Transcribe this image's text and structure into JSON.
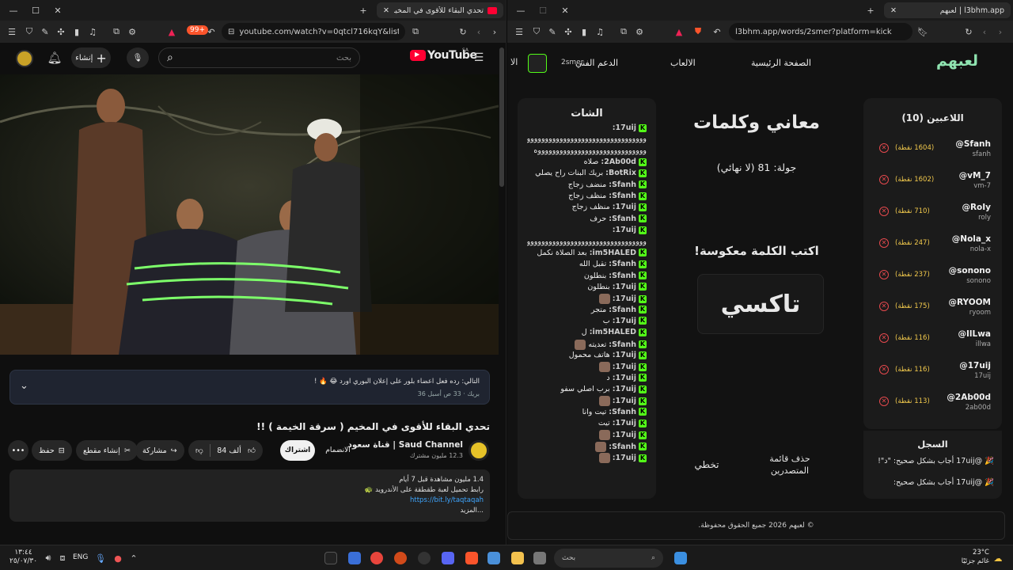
{
  "left_browser": {
    "tab_title": "تحدي البقاء للأقوى في المخيم (",
    "url": "youtube.com/watch?v=0qtcl716kqY&list=...",
    "badge_count": "99+"
  },
  "youtube": {
    "logo": "YouTube",
    "logo_region": "SA",
    "search_placeholder": "بحث",
    "create_label": "إنشاء",
    "comment_pinned": "التالي: رده فعل اعضاء بلور على إعلان البوري اورد 😂 🔥 !",
    "comment_meta": "بريك · 33 ص أسبل 36",
    "video_title": "تحدي البقاء للأقوى في المخيم ( سرقة الخيمة ) !!",
    "channel_name": "Saud Channel | قناة سعود",
    "subscribers": "12.3 مليون مشترك",
    "subscribe_label": "اشتراك",
    "join_label": "الانضمام",
    "likes": "84 ألف",
    "share_label": "مشاركة",
    "clip_label": "إنشاء مقطع",
    "save_label": "حفظ",
    "desc_stats": "1.4 مليون مشاهدة قبل 7 أيام",
    "desc_line2": "رابط تحميل لعبة طقطقة على الأندرويد 🐢",
    "desc_link": "https://bit.ly/taqtaqah",
    "desc_more": "...المزيد"
  },
  "right_browser": {
    "tab_title": "l3bhm.app | لعبهم",
    "url": "l3bhm.app/words/2smer?platform=kick"
  },
  "site": {
    "logo": "لعبهم",
    "nav": [
      "الصفحة الرئيسية",
      "الالعاب",
      "الدعم الفني",
      "الا"
    ],
    "username": "2smer",
    "players_title": "اللاعبين (10)",
    "players": [
      {
        "name": "@Sfanh",
        "sub": "sfanh",
        "points": "(1604 نقطة)"
      },
      {
        "name": "@vM_7",
        "sub": "vm-7",
        "points": "(1602 نقطة)"
      },
      {
        "name": "@RoIy",
        "sub": "roly",
        "points": "(710 نقطة)"
      },
      {
        "name": "@Nola_x",
        "sub": "nola-x",
        "points": "(247 نقطة)"
      },
      {
        "name": "@sonono",
        "sub": "sonono",
        "points": "(237 نقطة)"
      },
      {
        "name": "@RYOOM",
        "sub": "ryoom",
        "points": "(175 نقطة)"
      },
      {
        "name": "@IlLwa",
        "sub": "illwa",
        "points": "(116 نقطة)"
      },
      {
        "name": "@17uij",
        "sub": "17uij",
        "points": "(116 نقطة)"
      },
      {
        "name": "@2Ab00d",
        "sub": "2ab00d",
        "points": "(113 نقطة)"
      }
    ],
    "game_title": "معاني وكلمات",
    "round": "جولة: 81 (لا نهائي)",
    "instruction": "اكتب الكلمة معكوسة!",
    "word": "تاكسي",
    "skip": "تخطي",
    "clear_leaderboard": "حذف قائمة المتصدرين",
    "log_title": "السجل",
    "log": [
      "🎉 @17uij أجاب بشكل صحيح: \"د\"!",
      "🎉 @17uij أجاب بشكل صحيح:"
    ],
    "chat_title": "الشات",
    "chat": [
      {
        "u": "17uij:",
        "t": ""
      },
      {
        "u": "",
        "t": "ووووووووووووووووووووووووووووووووو"
      },
      {
        "u": "",
        "t": "ووووووووووووووووووووووووووووووه"
      },
      {
        "u": "2Ab00d:",
        "t": "صلاه"
      },
      {
        "u": "BotRix:",
        "t": "بريك البنات راح يصلي"
      },
      {
        "u": "Sfanh:",
        "t": "منضف زجاج"
      },
      {
        "u": "Sfanh:",
        "t": "منظف زجاج"
      },
      {
        "u": "17uij:",
        "t": "منظف زجاج"
      },
      {
        "u": "Sfanh:",
        "t": "حرف"
      },
      {
        "u": "17uij:",
        "t": ""
      },
      {
        "u": "",
        "t": "ووووووووووووووووووووووووووووووووو"
      },
      {
        "u": "im5HALED:",
        "t": "بعد الصلاة نكمل"
      },
      {
        "u": "Sfanh:",
        "t": "تقبل الله"
      },
      {
        "u": "Sfanh:",
        "t": "بنطلون"
      },
      {
        "u": "17uij:",
        "t": "بنطلون"
      },
      {
        "u": "17uij:",
        "t": "EMOTE"
      },
      {
        "u": "Sfanh:",
        "t": "متجر"
      },
      {
        "u": "17uij:",
        "t": "ب"
      },
      {
        "u": "im5HALED:",
        "t": "ل"
      },
      {
        "u": "Sfanh:",
        "t": "تعديته EMOTE"
      },
      {
        "u": "17uij:",
        "t": "هاتف محمول"
      },
      {
        "u": "17uij:",
        "t": "EMOTE"
      },
      {
        "u": "17uij:",
        "t": "د"
      },
      {
        "u": "17uij:",
        "t": "برب اصلي سفو"
      },
      {
        "u": "17uij:",
        "t": "EMOTE"
      },
      {
        "u": "Sfanh:",
        "t": "تيت وانا"
      },
      {
        "u": "17uij:",
        "t": "تيت"
      },
      {
        "u": "17uij:",
        "t": "EMOTE"
      },
      {
        "u": "Sfanh:",
        "t": "EMOTE"
      },
      {
        "u": "17uij:",
        "t": "EMOTE"
      }
    ],
    "footer": "© لعبهم 2026 جميع الحقوق محفوظة."
  },
  "taskbar": {
    "time": "١٣:٤٤",
    "date": "٢٥/٠٧/٣٠",
    "lang": "ENG",
    "search": "بحث",
    "weather_temp": "23°C",
    "weather_text": "غائم جزئيًا"
  },
  "colors": {
    "kick": "#53fc18",
    "youtube_red": "#ff0033",
    "points": "#f2c94c",
    "remove": "#e5484d"
  }
}
